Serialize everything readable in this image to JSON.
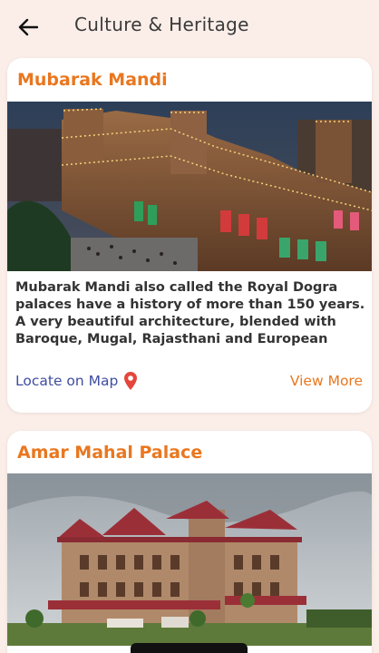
{
  "header": {
    "title": "Culture & Heritage",
    "back_icon": "arrow-left-icon"
  },
  "cards": [
    {
      "title": "Mubarak Mandi",
      "image": "illuminated-palace-photo",
      "description": "Mubarak Mandi also called the Royal Dogra palaces have a history of more than 150 years. A very beautiful architecture, blended with Baroque, Mugal, Rajasthani and European styles, attracts the",
      "locate_label": "Locate on Map",
      "locate_icon": "map-pin-icon",
      "view_more_label": "View More"
    },
    {
      "title": "Amar Mahal Palace",
      "image": "red-sandstone-palace-photo"
    }
  ],
  "colors": {
    "accent": "#e9771f",
    "link": "#3f4da0",
    "pin": "#e5463b",
    "background": "#fbeee9"
  }
}
